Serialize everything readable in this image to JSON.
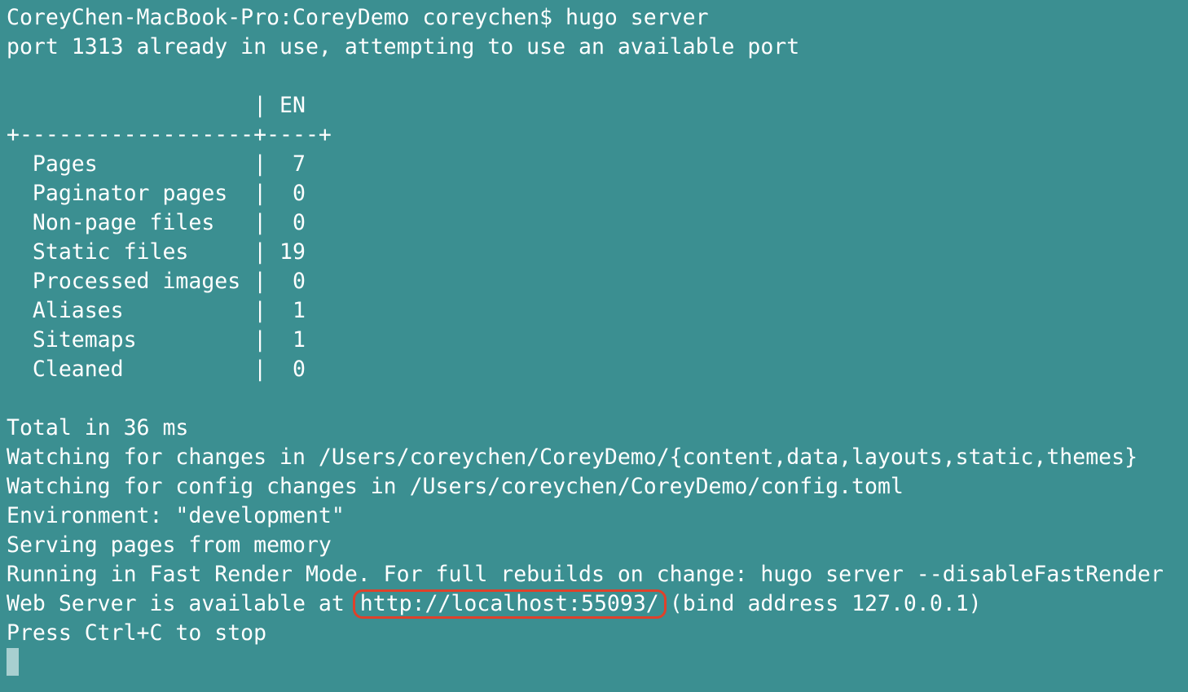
{
  "terminal": {
    "lines": {
      "prompt": "CoreyChen-MacBook-Pro:CoreyDemo coreychen$ hugo server",
      "port_notice": "port 1313 already in use, attempting to use an available port",
      "blank1": "",
      "table_header": "                   | EN",
      "table_divider": "+------------------+----+",
      "row_pages": "  Pages            |  7",
      "row_paginator": "  Paginator pages  |  0",
      "row_nonpage": "  Non-page files   |  0",
      "row_static": "  Static files     | 19",
      "row_processed": "  Processed images |  0",
      "row_aliases": "  Aliases          |  1",
      "row_sitemaps": "  Sitemaps         |  1",
      "row_cleaned": "  Cleaned          |  0",
      "blank2": "",
      "total": "Total in 36 ms",
      "watch_content": "Watching for changes in /Users/coreychen/CoreyDemo/{content,data,layouts,static,themes}",
      "watch_config": "Watching for config changes in /Users/coreychen/CoreyDemo/config.toml",
      "environment": "Environment: \"development\"",
      "serving": "Serving pages from memory",
      "fast_render": "Running in Fast Render Mode. For full rebuilds on change: hugo server --disableFastRender",
      "web_server_prefix": "Web Server is available at ",
      "web_server_url": "http://localhost:55093/",
      "web_server_suffix": "(bind address 127.0.0.1)",
      "stop_hint": "Press Ctrl+C to stop"
    },
    "colors": {
      "background": "#3b8f91",
      "text": "#ffffff",
      "highlight": "#e0412a",
      "cursor": "#a8cfd0"
    }
  }
}
